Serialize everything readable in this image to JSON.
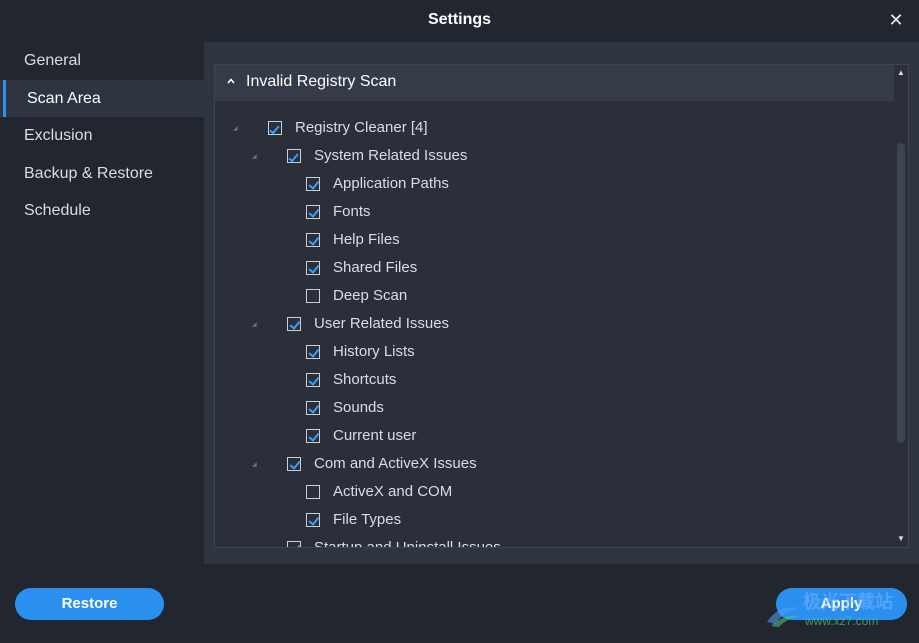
{
  "window": {
    "title": "Settings",
    "close_glyph": "✕"
  },
  "sidebar": {
    "items": [
      {
        "label": "General",
        "active": false
      },
      {
        "label": "Scan Area",
        "active": true
      },
      {
        "label": "Exclusion",
        "active": false
      },
      {
        "label": "Backup & Restore",
        "active": false
      },
      {
        "label": "Schedule",
        "active": false
      }
    ]
  },
  "main": {
    "section_title": "Invalid Registry Scan",
    "section_icon": "chevron-up-icon",
    "tree": [
      {
        "label": "Registry Cleaner [4]",
        "state": "partial",
        "level": 0
      },
      {
        "label": "System Related Issues",
        "state": "partial",
        "level": 1
      },
      {
        "label": "Application Paths",
        "state": "checked",
        "level": 2
      },
      {
        "label": "Fonts",
        "state": "checked",
        "level": 2
      },
      {
        "label": "Help Files",
        "state": "checked",
        "level": 2
      },
      {
        "label": "Shared Files",
        "state": "checked",
        "level": 2
      },
      {
        "label": "Deep Scan",
        "state": "unchecked",
        "level": 2
      },
      {
        "label": "User Related Issues",
        "state": "checked",
        "level": 1
      },
      {
        "label": "History Lists",
        "state": "checked",
        "level": 2
      },
      {
        "label": "Shortcuts",
        "state": "checked",
        "level": 2
      },
      {
        "label": "Sounds",
        "state": "checked",
        "level": 2
      },
      {
        "label": "Current user",
        "state": "checked",
        "level": 2
      },
      {
        "label": "Com and ActiveX Issues",
        "state": "checked",
        "level": 1
      },
      {
        "label": "ActiveX and COM",
        "state": "unchecked",
        "level": 2
      },
      {
        "label": "File Types",
        "state": "checked",
        "level": 2
      },
      {
        "label": "Startup and Uninstall Issues",
        "state": "checked",
        "level": 1
      }
    ]
  },
  "footer": {
    "restore_label": "Restore",
    "apply_label": "Apply"
  },
  "watermark": {
    "text": "极光下载站",
    "url": "www.xz7.com"
  },
  "colors": {
    "accent": "#2b8ff0",
    "background": "#22262f",
    "panel": "#2e3440",
    "checkmark": "#3aa0ff"
  }
}
